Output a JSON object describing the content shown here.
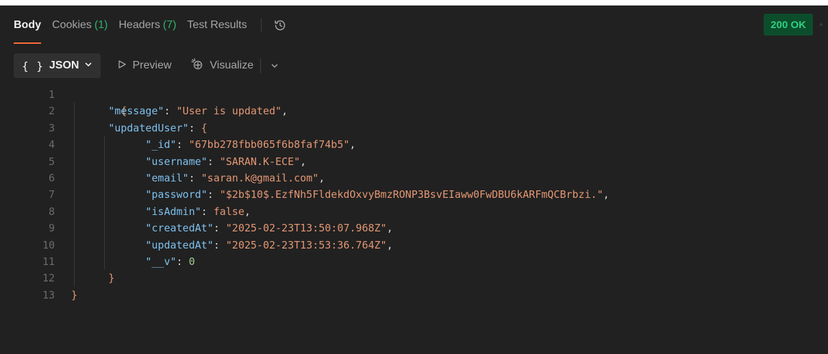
{
  "tabs": [
    {
      "label": "Body",
      "count": "",
      "active": true
    },
    {
      "label": "Cookies",
      "count": "(1)",
      "active": false
    },
    {
      "label": "Headers",
      "count": "(7)",
      "active": false
    },
    {
      "label": "Test Results",
      "count": "",
      "active": false
    }
  ],
  "history_icon": "history-icon",
  "status": {
    "text": "200 OK",
    "color": "#2fd07f",
    "background": "#0c4d2c"
  },
  "toolbar": {
    "format_braces": "{ }",
    "format_label": "JSON",
    "preview_label": "Preview",
    "visualize_label": "Visualize"
  },
  "code_lines": [
    {
      "n": "1"
    },
    {
      "n": "2"
    },
    {
      "n": "3"
    },
    {
      "n": "4"
    },
    {
      "n": "5"
    },
    {
      "n": "6"
    },
    {
      "n": "7"
    },
    {
      "n": "8"
    },
    {
      "n": "9"
    },
    {
      "n": "10"
    },
    {
      "n": "11"
    },
    {
      "n": "12"
    },
    {
      "n": "13"
    }
  ],
  "json": {
    "open_brace": "{",
    "close_brace": "}",
    "message_key": "\"message\"",
    "message_value": "\"User is updated\"",
    "updatedUser_key": "\"updatedUser\"",
    "id_key": "\"_id\"",
    "id_value": "\"67bb278fbb065f6b8faf74b5\"",
    "username_key": "\"username\"",
    "username_value": "\"SARAN.K-ECE\"",
    "email_key": "\"email\"",
    "email_value": "\"saran.k@gmail.com\"",
    "password_key": "\"password\"",
    "password_value": "\"$2b$10$.EzfNh5FldekdOxvyBmzRONP3BsvEIaww0FwDBU6kARFmQCBrbzi.\"",
    "isAdmin_key": "\"isAdmin\"",
    "isAdmin_value": "false",
    "createdAt_key": "\"createdAt\"",
    "createdAt_value": "\"2025-02-23T13:50:07.968Z\"",
    "updatedAt_key": "\"updatedAt\"",
    "updatedAt_value": "\"2025-02-23T13:53:36.764Z\"",
    "v_key": "\"__v\"",
    "v_value": "0"
  },
  "colors": {
    "accent": "#ff6c37",
    "count": "#2fb36b",
    "key": "#7ec0ee",
    "string": "#e39774",
    "number": "#9ccc8c"
  }
}
